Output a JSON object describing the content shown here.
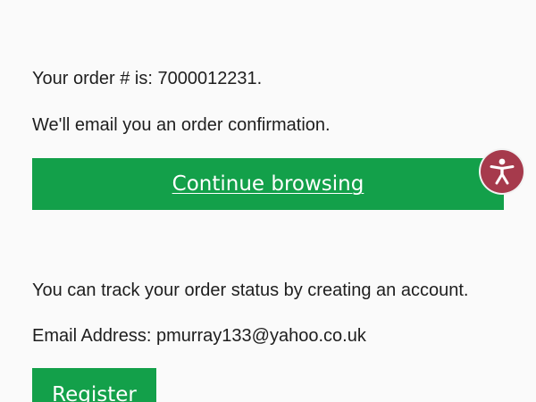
{
  "order": {
    "number_line": "Your order # is: 7000012231.",
    "confirmation_line": "We'll email you an order confirmation."
  },
  "buttons": {
    "continue_label": "Continue browsing",
    "register_label": "Register"
  },
  "account": {
    "track_line": "You can track your order status by creating an account.",
    "email_line": "Email Address: pmurray133@yahoo.co.uk"
  },
  "colors": {
    "primary_green": "#13a04a",
    "accessibility_badge": "#a63a4c"
  },
  "icons": {
    "accessibility": "accessibility-person-icon"
  }
}
